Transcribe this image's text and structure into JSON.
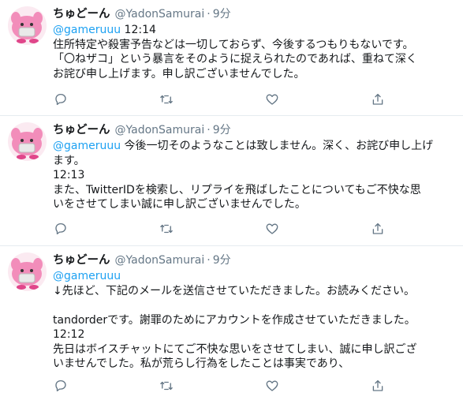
{
  "tweets": [
    {
      "name": "ちゅどーん",
      "handle": "@YadonSamurai",
      "dot": "·",
      "time": "9分",
      "lines": [
        {
          "mention": "@gameruuu",
          "text": " 12:14"
        },
        {
          "text": "住所特定や殺害予告などは一切しておらず、今後するつもりもないです。"
        },
        {
          "text": "「〇ねザコ」という暴言をそのように捉えられたのであれば、重ねて深く"
        },
        {
          "text": "お詫び申し上げます。申し訳ございませんでした。"
        }
      ]
    },
    {
      "name": "ちゅどーん",
      "handle": "@YadonSamurai",
      "dot": "·",
      "time": "9分",
      "lines": [
        {
          "mention": "@gameruuu",
          "text": " 今後一切そのようなことは致しません。深く、お詫び申し上げ"
        },
        {
          "text": "ます。"
        },
        {
          "text": "12:13"
        },
        {
          "text": "また、TwitterIDを検索し、リプライを飛ばしたことについてもご不快な思"
        },
        {
          "text": "いをさせてしまい誠に申し訳ございませんでした。"
        }
      ]
    },
    {
      "name": "ちゅどーん",
      "handle": "@YadonSamurai",
      "dot": "·",
      "time": "9分",
      "lines": [
        {
          "mention": "@gameruuu"
        },
        {
          "text": "↓先ほど、下記のメールを送信させていただきました。お読みください。"
        },
        {
          "text": ""
        },
        {
          "text": "tandorderです。謝罪のためにアカウントを作成させていただきました。"
        },
        {
          "text": "12:12"
        },
        {
          "text": "先日はボイスチャットにてご不快な思いをさせてしまい、誠に申し訳ござ"
        },
        {
          "text": "いませんでした。私が荒らし行為をしたことは事実であり、"
        }
      ]
    }
  ],
  "icons": {
    "reply": "reply-icon",
    "retweet": "retweet-icon",
    "like": "like-icon",
    "share": "share-icon",
    "avatar": "pink-character-avatar"
  },
  "colors": {
    "text": "#14171a",
    "muted": "#657786",
    "mention": "#1da1f2",
    "divider": "#e6ecf0",
    "icon": "#657786"
  }
}
